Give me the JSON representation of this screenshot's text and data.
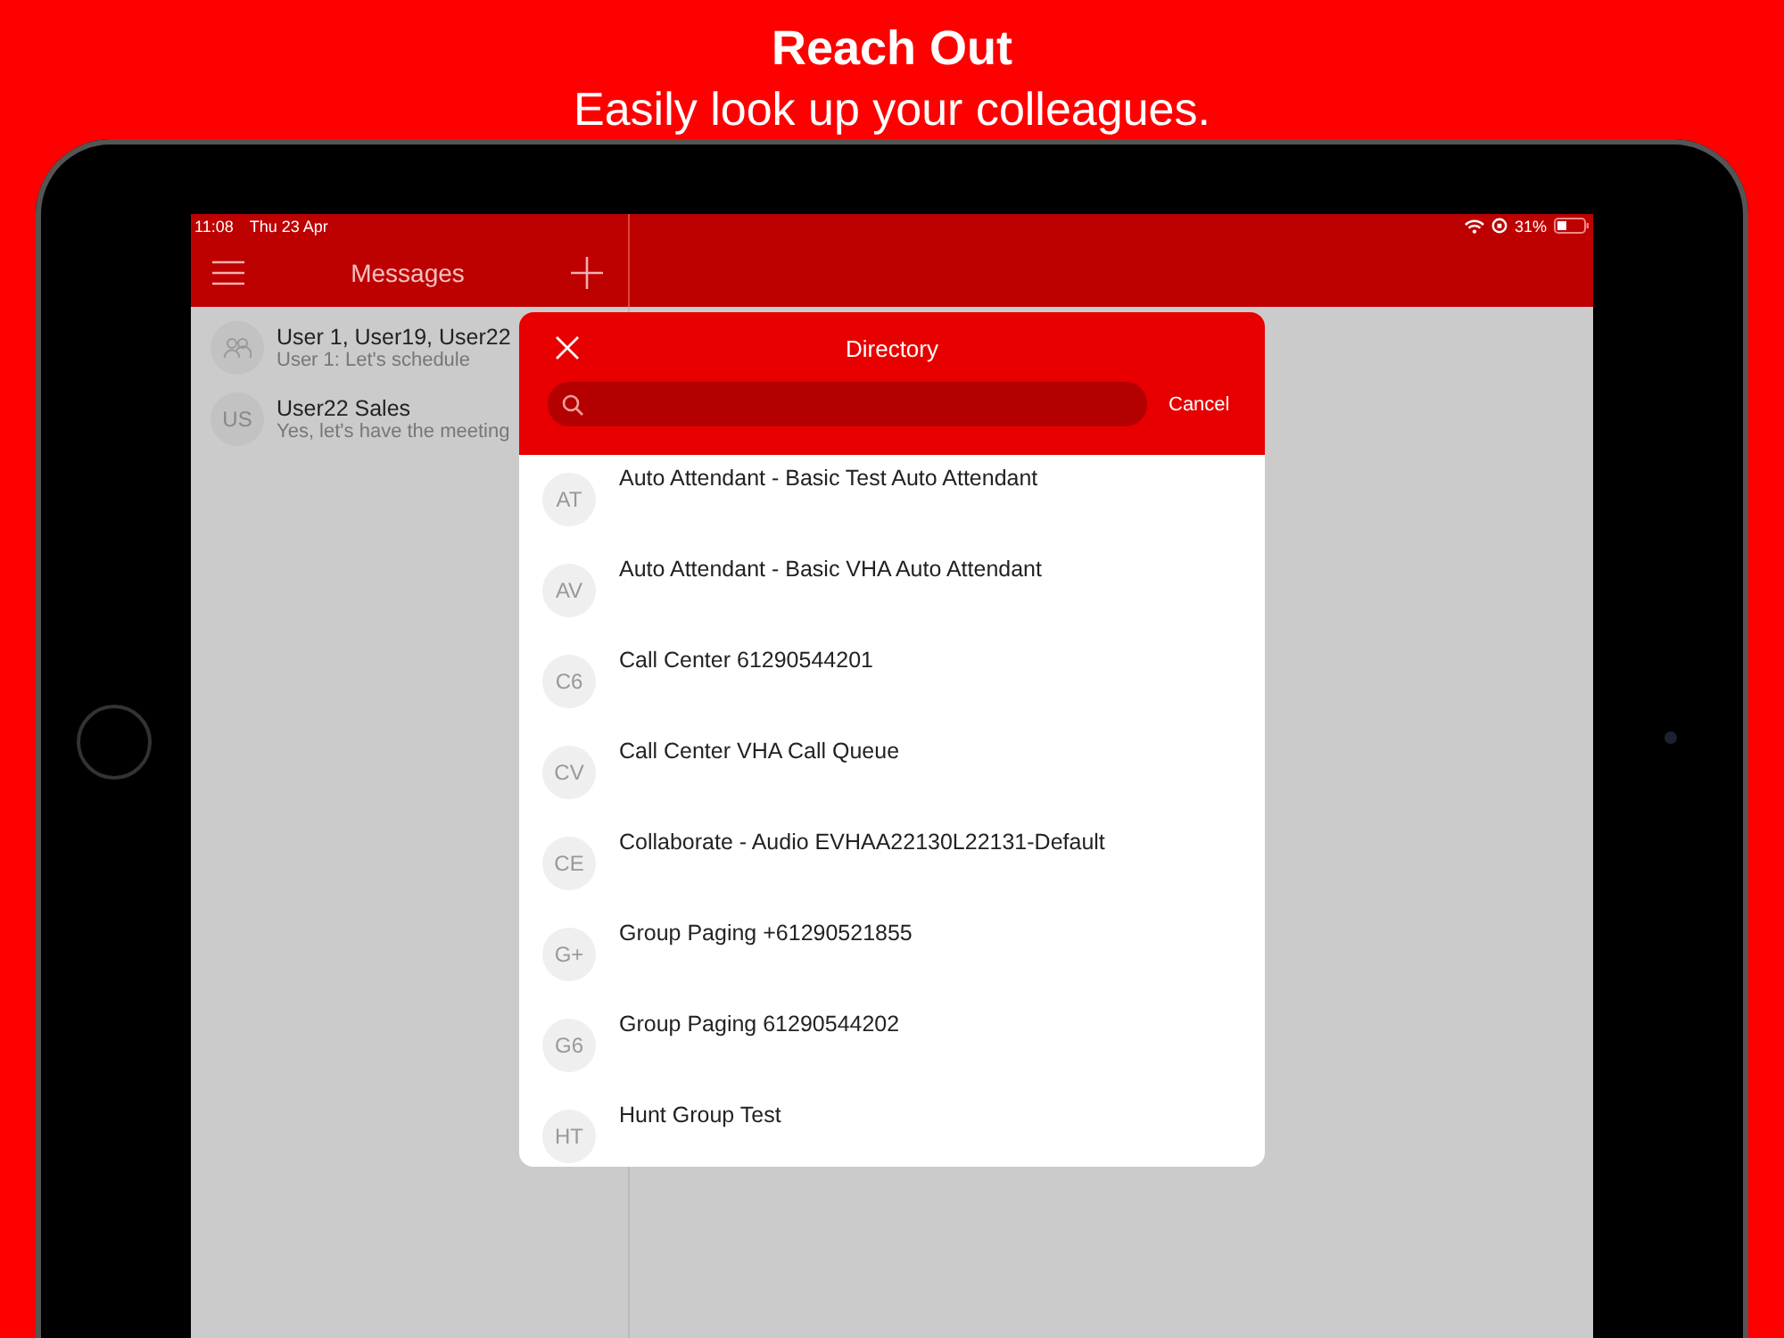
{
  "headline": {
    "title": "Reach Out",
    "subtitle": "Easily look up your colleagues."
  },
  "status_bar": {
    "time": "11:08",
    "date": "Thu 23 Apr",
    "battery": "31%"
  },
  "nav": {
    "title": "Messages"
  },
  "conversations": [
    {
      "kind": "group",
      "title": "User 1, User19, User22",
      "preview": "User 1: Let's schedule"
    },
    {
      "kind": "initials",
      "initials": "US",
      "title": "User22 Sales",
      "preview": "Yes, let's have the meeting"
    }
  ],
  "directory": {
    "title": "Directory",
    "cancel": "Cancel",
    "entries": [
      {
        "initials": "AT",
        "name": "Auto Attendant - Basic Test Auto Attendant"
      },
      {
        "initials": "AV",
        "name": "Auto Attendant - Basic VHA Auto Attendant"
      },
      {
        "initials": "C6",
        "name": "Call Center 61290544201"
      },
      {
        "initials": "CV",
        "name": "Call Center VHA Call Queue"
      },
      {
        "initials": "CE",
        "name": "Collaborate - Audio EVHAA22130L22131-Default"
      },
      {
        "initials": "G+",
        "name": "Group Paging +61290521855"
      },
      {
        "initials": "G6",
        "name": "Group Paging 61290544202"
      },
      {
        "initials": "HT",
        "name": "Hunt Group Test"
      }
    ]
  }
}
